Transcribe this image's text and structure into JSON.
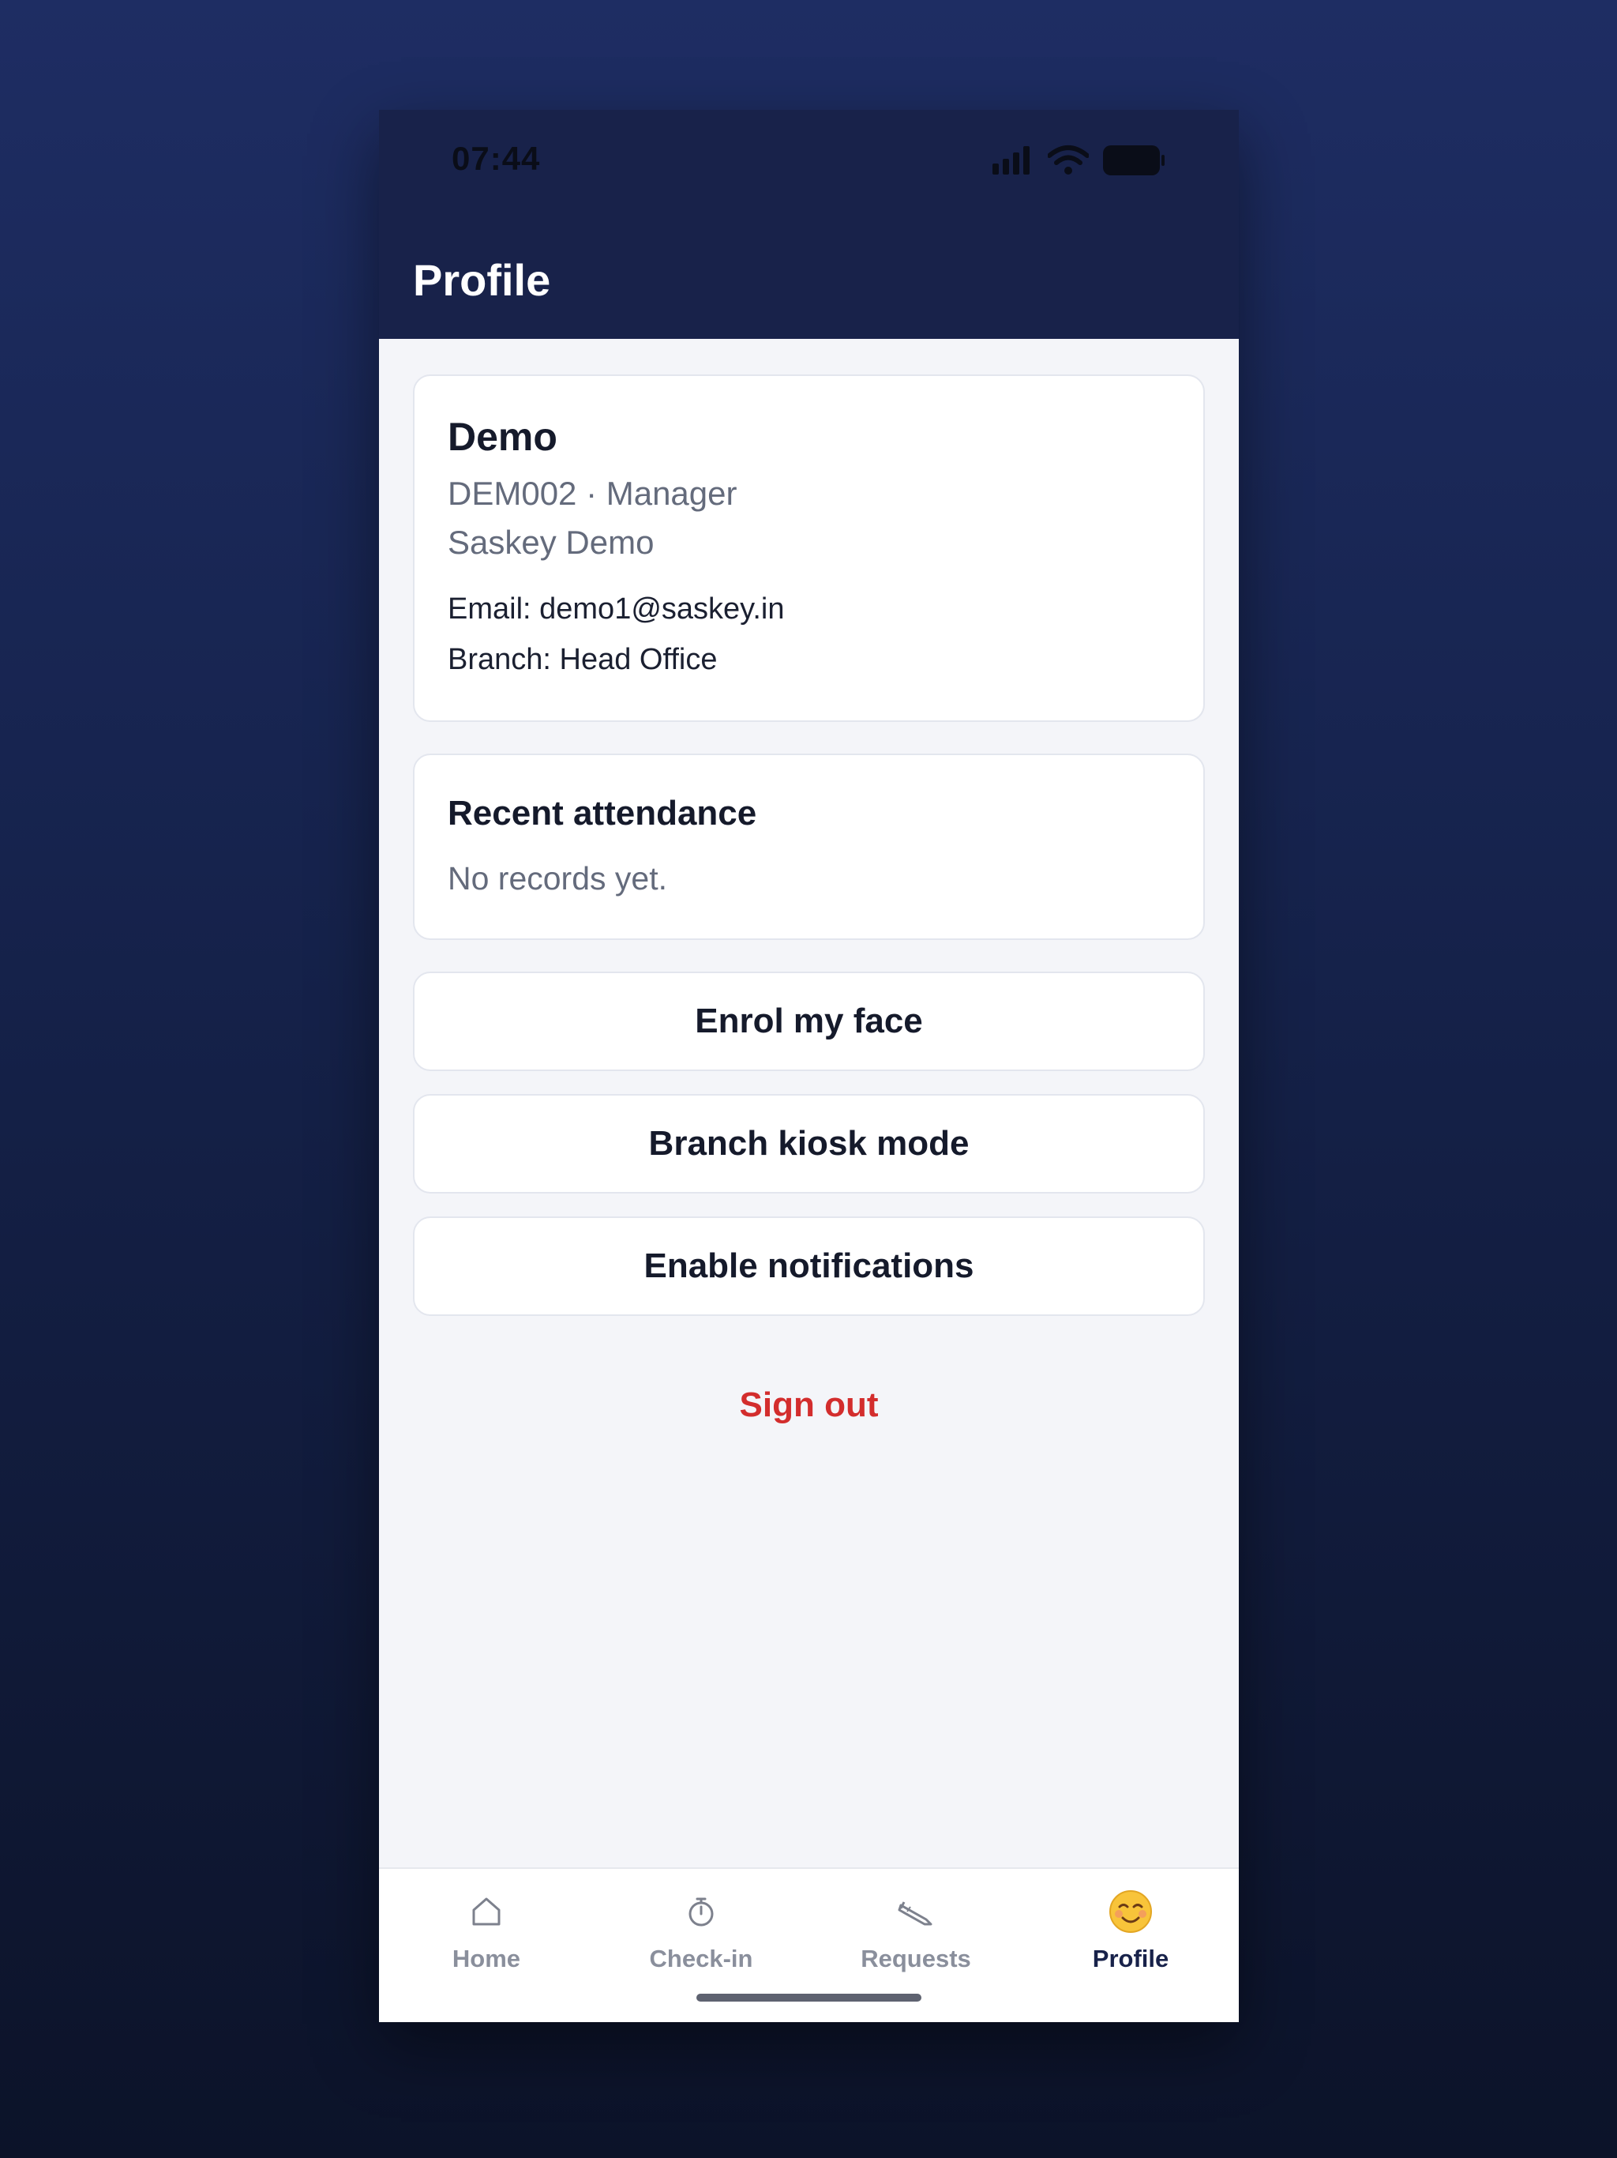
{
  "status_bar": {
    "time": "07:44"
  },
  "header": {
    "title": "Profile"
  },
  "profile": {
    "name": "Demo",
    "meta": "DEM002 · Manager",
    "organization": "Saskey Demo",
    "email": "Email: demo1@saskey.in",
    "branch": "Branch: Head Office"
  },
  "attendance": {
    "title": "Recent attendance",
    "empty_message": "No records yet."
  },
  "actions": {
    "enrol_face": "Enrol my face",
    "kiosk_mode": "Branch kiosk mode",
    "notifications": "Enable notifications",
    "sign_out": "Sign out"
  },
  "tabs": [
    {
      "label": "Home",
      "icon": "home-icon"
    },
    {
      "label": "Check-in",
      "icon": "stopwatch-icon"
    },
    {
      "label": "Requests",
      "icon": "pencil-icon"
    },
    {
      "label": "Profile",
      "icon": "smiling-face-icon"
    }
  ],
  "active_tab": "Profile",
  "colors": {
    "header_bg": "#18224a",
    "sign_out": "#d32d2d",
    "active_tab": "#18224a",
    "inactive_tab": "#8a8f9c"
  }
}
